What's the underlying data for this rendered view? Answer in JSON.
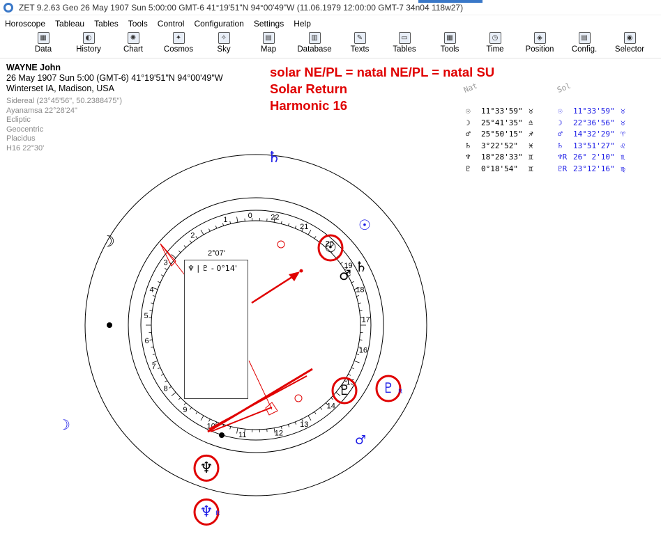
{
  "window": {
    "title": "ZET 9.2.63 Geo   26 May 1907  Sun   5:00:00 GMT-6 41°19'51\"N  94°00'49\"W  (11.06.1979  12:00:00 GMT-7 34n04 118w27)"
  },
  "menu": [
    "Horoscope",
    "Tableau",
    "Tables",
    "Tools",
    "Control",
    "Configuration",
    "Settings",
    "Help"
  ],
  "toolbar": [
    {
      "label": "Data",
      "icon": "data-icon",
      "glyph": "▦"
    },
    {
      "label": "History",
      "icon": "history-icon",
      "glyph": "◐"
    },
    {
      "label": "Chart",
      "icon": "chart-icon",
      "glyph": "✺"
    },
    {
      "label": "Cosmos",
      "icon": "cosmos-icon",
      "glyph": "✦"
    },
    {
      "label": "Sky",
      "icon": "sky-icon",
      "glyph": "✧"
    },
    {
      "label": "Map",
      "icon": "map-icon",
      "glyph": "▤"
    },
    {
      "label": "Database",
      "icon": "database-icon",
      "glyph": "▥"
    },
    {
      "label": "Texts",
      "icon": "texts-icon",
      "glyph": "✎"
    },
    {
      "label": "Tables",
      "icon": "tables-icon",
      "glyph": "▭"
    },
    {
      "label": "Tools",
      "icon": "tools-icon",
      "glyph": "▦"
    },
    {
      "label": "Time",
      "icon": "time-icon",
      "glyph": "◷"
    },
    {
      "label": "Position",
      "icon": "position-icon",
      "glyph": "◈"
    },
    {
      "label": "Config.",
      "icon": "config-icon",
      "glyph": "▤"
    },
    {
      "label": "Selector",
      "icon": "selector-icon",
      "glyph": "◉"
    }
  ],
  "chart_info": {
    "name": "WAYNE John",
    "line1": "26 May 1907  Sun   5:00 (GMT-6) 41°19'51\"N  94°00'49\"W",
    "line2": "Winterset IA, Madison, USA",
    "sidereal": "Sidereal (23°45'56\", 50.2388475\")",
    "ayanamsa": "Ayanamsa 22°28'24\"",
    "ecliptic": "Ecliptic",
    "geocentric": "Geocentric",
    "placidus": "Placidus",
    "harmonic": "H16  22°30'"
  },
  "annotation": {
    "line1": "solar NE/PL = natal NE/PL = natal SU",
    "line2": "Solar Return",
    "line3": "Harmonic 16"
  },
  "table": {
    "col_nat": "Nat",
    "col_sol": "Sol",
    "rows": [
      {
        "nat_glyph": "☉",
        "nat_pos": "11°33'59\"",
        "nat_sign": "♉",
        "sol_glyph": "☉",
        "sol_pos": "11°33'59\"",
        "sol_sign": "♉"
      },
      {
        "nat_glyph": "☽",
        "nat_pos": "25°41'35\"",
        "nat_sign": "♎",
        "sol_glyph": "☽",
        "sol_pos": "22°36'56\"",
        "sol_sign": "♉"
      },
      {
        "nat_glyph": "♂",
        "nat_pos": "25°50'15\"",
        "nat_sign": "♐",
        "sol_glyph": "♂",
        "sol_pos": "14°32'29\"",
        "sol_sign": "♈"
      },
      {
        "nat_glyph": "♄",
        "nat_pos": " 3°22'52\"",
        "nat_sign": "♓",
        "sol_glyph": "♄",
        "sol_pos": "13°51'27\"",
        "sol_sign": "♌"
      },
      {
        "nat_glyph": "♆",
        "nat_pos": "18°28'33\"",
        "nat_sign": "♊",
        "sol_glyph": "♆R",
        "sol_pos": "26° 2'10\"",
        "sol_sign": "♏"
      },
      {
        "nat_glyph": "♇",
        "nat_pos": " 0°18'54\"",
        "nat_sign": "♊",
        "sol_glyph": "♇R",
        "sol_pos": "23°12'16\"",
        "sol_sign": "♍"
      }
    ]
  },
  "wheel": {
    "house_numbers": [
      "0",
      "22",
      "21",
      "20",
      "19",
      "18",
      "17",
      "16",
      "15",
      "14",
      "13",
      "12",
      "11",
      "10",
      "9",
      "8",
      "7",
      "6",
      "5",
      "4",
      "3",
      "2",
      "1"
    ],
    "tooltip_title": "2°07'",
    "tooltip_text": "♆ | ♇ - 0°14'",
    "glyphs": {
      "sol_saturn": "♄",
      "sol_sun": "☉",
      "sol_pluto": "♇",
      "sol_mars": "♂",
      "sol_moon": "☽",
      "sol_neptune": "♆",
      "nat_moon": "☽",
      "nat_sun": "☉",
      "nat_mars": "♂",
      "nat_saturn": "♄",
      "nat_pluto": "♇",
      "nat_neptune": "♆",
      "retro": "R"
    }
  }
}
